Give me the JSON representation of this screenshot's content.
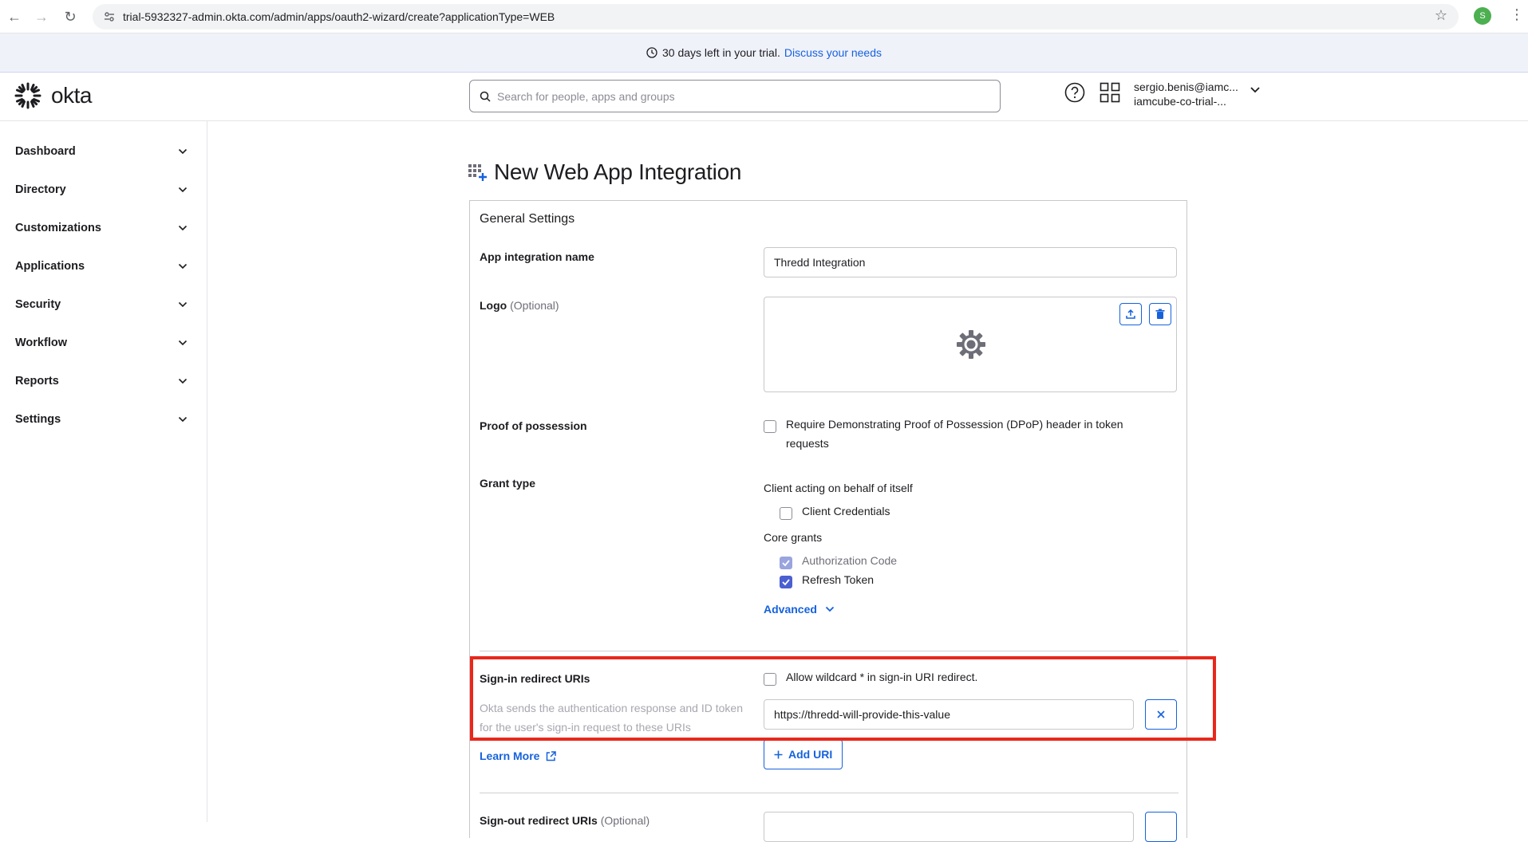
{
  "browser": {
    "url": "trial-5932327-admin.okta.com/admin/apps/oauth2-wizard/create?applicationType=WEB",
    "profile_initial": "S"
  },
  "banner": {
    "text": "30 days left in your trial.",
    "link": "Discuss your needs"
  },
  "header": {
    "logo_text": "okta",
    "search_placeholder": "Search for people, apps and groups",
    "user_email": "sergio.benis@iamc...",
    "user_org": "iamcube-co-trial-..."
  },
  "sidebar": {
    "items": [
      {
        "label": "Dashboard"
      },
      {
        "label": "Directory"
      },
      {
        "label": "Customizations"
      },
      {
        "label": "Applications"
      },
      {
        "label": "Security"
      },
      {
        "label": "Workflow"
      },
      {
        "label": "Reports"
      },
      {
        "label": "Settings"
      }
    ]
  },
  "page": {
    "title": "New Web App Integration",
    "section_title": "General Settings",
    "app_name_label": "App integration name",
    "app_name_value": "Thredd Integration",
    "logo_label": "Logo",
    "logo_optional": "(Optional)",
    "pop_label": "Proof of possession",
    "pop_checkbox": "Require Demonstrating Proof of Possession (DPoP) header in token requests",
    "grant_label": "Grant type",
    "grant_self": "Client acting on behalf of itself",
    "grant_client_credentials": "Client Credentials",
    "grant_core": "Core grants",
    "grant_auth_code": "Authorization Code",
    "grant_refresh": "Refresh Token",
    "advanced": "Advanced",
    "signin_label": "Sign-in redirect URIs",
    "signin_desc": "Okta sends the authentication response and ID token for the user's sign-in request to these URIs",
    "wildcard_checkbox": "Allow wildcard * in sign-in URI redirect.",
    "signin_uri_value": "https://thredd-will-provide-this-value",
    "learn_more": "Learn More",
    "add_uri": "Add URI",
    "signout_label": "Sign-out redirect URIs",
    "signout_optional": "(Optional)"
  },
  "colors": {
    "accent": "#1662dd",
    "highlight": "#e8281b",
    "checkbox_checked": "#4b5fd1"
  }
}
